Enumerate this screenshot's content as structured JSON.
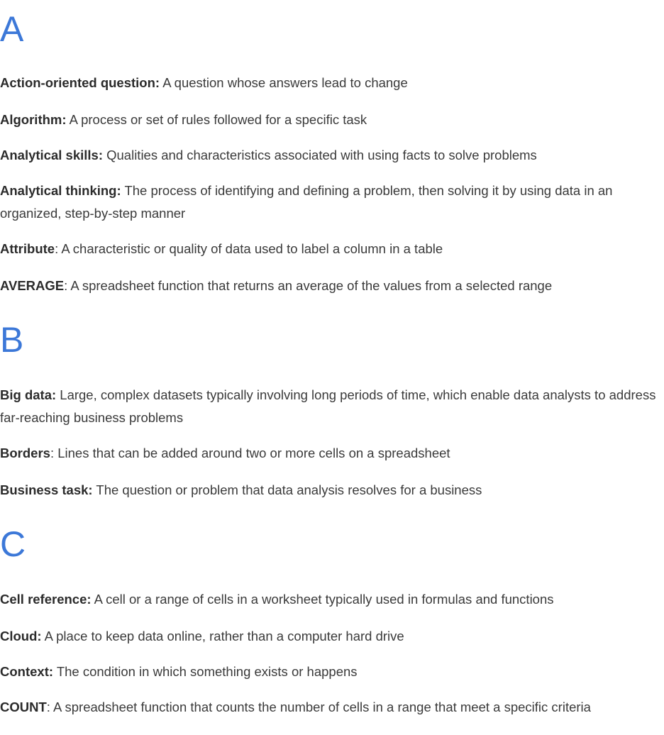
{
  "sections": [
    {
      "letter": "A",
      "entries": [
        {
          "term": "Action-oriented question:",
          "definition": " A question whose answers lead to change"
        },
        {
          "term": "Algorithm:",
          "definition": " A process or set of rules followed for a specific task"
        },
        {
          "term": "Analytical skills:",
          "definition": " Qualities and characteristics associated with using facts to solve problems"
        },
        {
          "term": "Analytical thinking:",
          "definition": " The process of identifying and defining a problem, then solving it by using data in an organized, step-by-step manner"
        },
        {
          "term": "Attribute",
          "definition": ": A characteristic or quality of data used to label a column in a table"
        },
        {
          "term": "AVERAGE",
          "definition": ": A spreadsheet function that returns an average of the values from a selected range"
        }
      ]
    },
    {
      "letter": "B",
      "entries": [
        {
          "term": "Big data:",
          "definition": " Large, complex datasets typically involving long periods of time, which enable data analysts to address far-reaching business problems"
        },
        {
          "term": "Borders",
          "definition": ": Lines that can be added around two or more cells on a spreadsheet"
        },
        {
          "term": "Business task:",
          "definition": " The question or problem that data analysis resolves for a business"
        }
      ]
    },
    {
      "letter": "C",
      "entries": [
        {
          "term": "Cell reference:",
          "definition": " A cell or a range of cells in a worksheet typically used in formulas and functions"
        },
        {
          "term": "Cloud:",
          "definition": " A place to keep data online, rather than a computer hard drive"
        },
        {
          "term": "Context:",
          "definition": " The condition in which something exists or happens"
        },
        {
          "term": "COUNT",
          "definition": ": A spreadsheet function that counts the number of cells in a range that meet a specific criteria"
        }
      ]
    }
  ],
  "colors": {
    "heading": "#3c78d8",
    "text": "#333333"
  }
}
